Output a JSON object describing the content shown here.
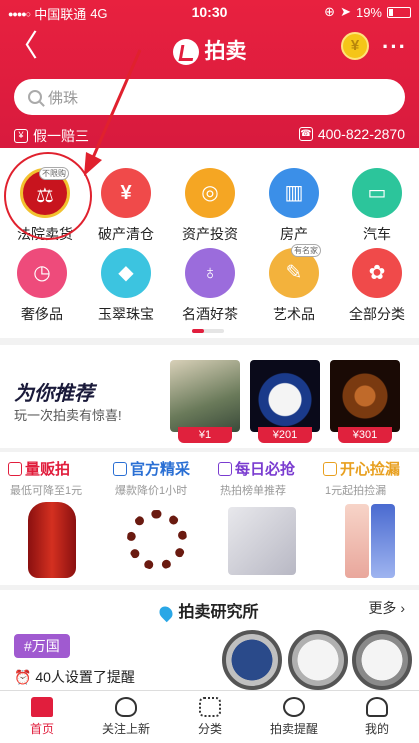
{
  "status_bar": {
    "carrier": "中国联通",
    "network": "4G",
    "time": "10:30",
    "battery": "19%"
  },
  "nav": {
    "title": "拍卖"
  },
  "search": {
    "placeholder": "佛珠"
  },
  "promo": {
    "guarantee": "假一赔三",
    "phone": "400-822-2870"
  },
  "categories": [
    {
      "label": "法院卖货",
      "tag": "不限购",
      "icon": "court-emblem-icon",
      "color": "#c8141e"
    },
    {
      "label": "破产清仓",
      "icon": "money-bag-icon",
      "color": "#f04a4a"
    },
    {
      "label": "资产投资",
      "icon": "coins-icon",
      "color": "#f5a623"
    },
    {
      "label": "房产",
      "icon": "building-icon",
      "color": "#3b8fe8"
    },
    {
      "label": "汽车",
      "icon": "car-icon",
      "color": "#2cc59b"
    },
    {
      "label": "奢侈品",
      "icon": "watch-icon",
      "color": "#ee4b7b"
    },
    {
      "label": "玉翠珠宝",
      "icon": "diamond-icon",
      "color": "#3cc4e0"
    },
    {
      "label": "名酒好茶",
      "icon": "wine-icon",
      "color": "#9b6cdc"
    },
    {
      "label": "艺术品",
      "tag": "有名家",
      "icon": "palette-icon",
      "color": "#f3b23c"
    },
    {
      "label": "全部分类",
      "icon": "grid-icon",
      "color": "#f04a4a"
    }
  ],
  "recommend": {
    "title": "为你推荐",
    "subtitle": "玩一次拍卖有惊喜!",
    "items": [
      {
        "price": "¥1"
      },
      {
        "price": "¥201"
      },
      {
        "price": "¥301"
      }
    ]
  },
  "deals": [
    {
      "title": "量贩拍",
      "desc": "最低可降至1元",
      "color": "#e11e3d"
    },
    {
      "title": "官方精采",
      "desc": "爆款降价1小时",
      "color": "#2a6fd4"
    },
    {
      "title": "每日必抢",
      "desc": "热拍榜单推荐",
      "color": "#7a3cd0"
    },
    {
      "title": "开心捡漏",
      "desc": "1元起拍捡漏",
      "color": "#e8a020"
    }
  ],
  "research": {
    "title": "拍卖研究所",
    "more": "更多",
    "topic": "#万国",
    "reminder": "40人设置了提醒"
  },
  "tabs": [
    {
      "label": "首页",
      "active": true
    },
    {
      "label": "关注上新"
    },
    {
      "label": "分类"
    },
    {
      "label": "拍卖提醒"
    },
    {
      "label": "我的"
    }
  ]
}
